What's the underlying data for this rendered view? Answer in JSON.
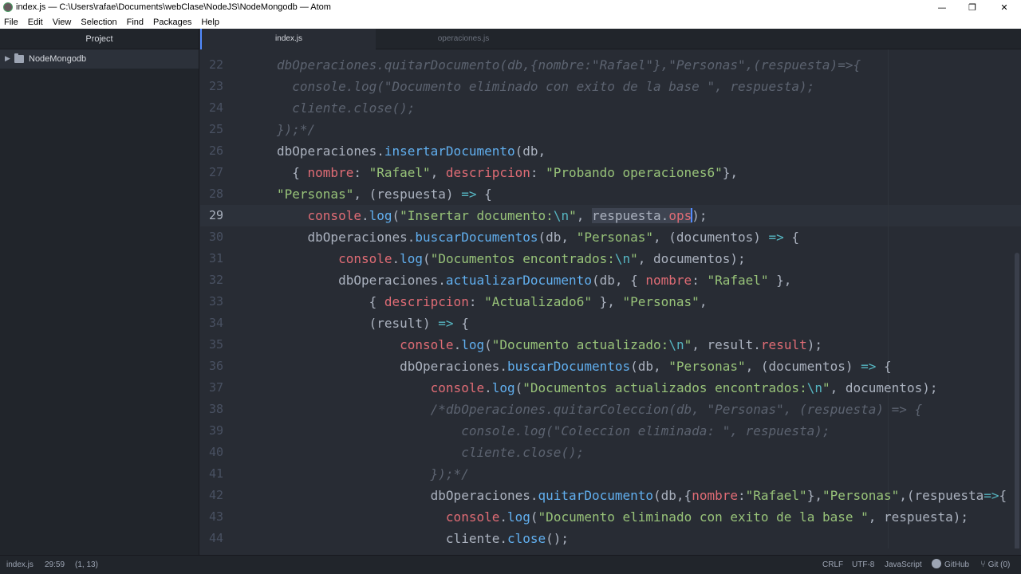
{
  "window": {
    "title": "index.js — C:\\Users\\rafae\\Documents\\webClase\\NodeJS\\NodeMongodb — Atom",
    "minimize_glyph": "—",
    "maximize_glyph": "❐",
    "close_glyph": "✕"
  },
  "menu": [
    "File",
    "Edit",
    "View",
    "Selection",
    "Find",
    "Packages",
    "Help"
  ],
  "tree": {
    "panel_title": "Project",
    "root_label": "NodeMongodb",
    "root_icon": "folder-icon"
  },
  "tabs": [
    {
      "label": "index.js",
      "active": true
    },
    {
      "label": "operaciones.js",
      "active": false
    }
  ],
  "editor": {
    "line_numbers": [
      "22",
      "23",
      "24",
      "25",
      "26",
      "27",
      "28",
      "29",
      "30",
      "31",
      "32",
      "33",
      "34",
      "35",
      "36",
      "37",
      "38",
      "39",
      "40",
      "41",
      "42",
      "43",
      "44"
    ],
    "current_line": "29",
    "lines": [
      [
        [
          "c",
          "dbOperaciones.quitarDocumento(db,{nombre:\"Rafael\"},\"Personas\",(respuesta)=>{"
        ]
      ],
      [
        [
          "c",
          "  console.log(\"Documento eliminado con exito de la base \", respuesta);"
        ]
      ],
      [
        [
          "c",
          "  cliente.close();"
        ]
      ],
      [
        [
          "c",
          "});*/"
        ]
      ],
      [
        [
          "t",
          "dbOperaciones."
        ],
        [
          "f",
          "insertarDocumento"
        ],
        [
          "t",
          "(db,"
        ]
      ],
      [
        [
          "t",
          "  { "
        ],
        [
          "k",
          "nombre"
        ],
        [
          "t",
          ": "
        ],
        [
          "s",
          "\"Rafael\""
        ],
        [
          "t",
          ", "
        ],
        [
          "k",
          "descripcion"
        ],
        [
          "t",
          ": "
        ],
        [
          "s",
          "\"Probando operaciones6\""
        ],
        [
          "t",
          "},"
        ]
      ],
      [
        [
          "s",
          "\"Personas\""
        ],
        [
          "t",
          ", (respuesta) "
        ],
        [
          "o",
          "=>"
        ],
        [
          "t",
          " {"
        ]
      ],
      [
        [
          "t",
          "    "
        ],
        [
          "k",
          "console"
        ],
        [
          "t",
          "."
        ],
        [
          "f",
          "log"
        ],
        [
          "t",
          "("
        ],
        [
          "s",
          "\"Insertar documento:"
        ],
        [
          "o",
          "\\n"
        ],
        [
          "s",
          "\""
        ],
        [
          "t",
          ", "
        ],
        [
          "sel",
          "respuesta."
        ],
        [
          "selk",
          "ops"
        ],
        [
          "caret",
          ""
        ],
        [
          "t",
          ");"
        ]
      ],
      [
        [
          "t",
          "    dbOperaciones."
        ],
        [
          "f",
          "buscarDocumentos"
        ],
        [
          "t",
          "(db, "
        ],
        [
          "s",
          "\"Personas\""
        ],
        [
          "t",
          ", (documentos) "
        ],
        [
          "o",
          "=>"
        ],
        [
          "t",
          " {"
        ]
      ],
      [
        [
          "t",
          "        "
        ],
        [
          "k",
          "console"
        ],
        [
          "t",
          "."
        ],
        [
          "f",
          "log"
        ],
        [
          "t",
          "("
        ],
        [
          "s",
          "\"Documentos encontrados:"
        ],
        [
          "o",
          "\\n"
        ],
        [
          "s",
          "\""
        ],
        [
          "t",
          ", documentos);"
        ]
      ],
      [
        [
          "t",
          "        dbOperaciones."
        ],
        [
          "f",
          "actualizarDocumento"
        ],
        [
          "t",
          "(db, { "
        ],
        [
          "k",
          "nombre"
        ],
        [
          "t",
          ": "
        ],
        [
          "s",
          "\"Rafael\""
        ],
        [
          "t",
          " },"
        ]
      ],
      [
        [
          "t",
          "            { "
        ],
        [
          "k",
          "descripcion"
        ],
        [
          "t",
          ": "
        ],
        [
          "s",
          "\"Actualizado6\""
        ],
        [
          "t",
          " }, "
        ],
        [
          "s",
          "\"Personas\""
        ],
        [
          "t",
          ","
        ]
      ],
      [
        [
          "t",
          "            (result) "
        ],
        [
          "o",
          "=>"
        ],
        [
          "t",
          " {"
        ]
      ],
      [
        [
          "t",
          "                "
        ],
        [
          "k",
          "console"
        ],
        [
          "t",
          "."
        ],
        [
          "f",
          "log"
        ],
        [
          "t",
          "("
        ],
        [
          "s",
          "\"Documento actualizado:"
        ],
        [
          "o",
          "\\n"
        ],
        [
          "s",
          "\""
        ],
        [
          "t",
          ", result."
        ],
        [
          "k",
          "result"
        ],
        [
          "t",
          ");"
        ]
      ],
      [
        [
          "t",
          "                dbOperaciones."
        ],
        [
          "f",
          "buscarDocumentos"
        ],
        [
          "t",
          "(db, "
        ],
        [
          "s",
          "\"Personas\""
        ],
        [
          "t",
          ", (documentos) "
        ],
        [
          "o",
          "=>"
        ],
        [
          "t",
          " {"
        ]
      ],
      [
        [
          "t",
          "                    "
        ],
        [
          "k",
          "console"
        ],
        [
          "t",
          "."
        ],
        [
          "f",
          "log"
        ],
        [
          "t",
          "("
        ],
        [
          "s",
          "\"Documentos actualizados encontrados:"
        ],
        [
          "o",
          "\\n"
        ],
        [
          "s",
          "\""
        ],
        [
          "t",
          ", documentos);"
        ]
      ],
      [
        [
          "t",
          "                    "
        ],
        [
          "c",
          "/*dbOperaciones.quitarColeccion(db, \"Personas\", (respuesta) => {"
        ]
      ],
      [
        [
          "c",
          "                        console.log(\"Coleccion eliminada: \", respuesta);"
        ]
      ],
      [
        [
          "c",
          "                        cliente.close();"
        ]
      ],
      [
        [
          "c",
          "                    });*/"
        ]
      ],
      [
        [
          "t",
          "                    dbOperaciones."
        ],
        [
          "f",
          "quitarDocumento"
        ],
        [
          "t",
          "(db,{"
        ],
        [
          "k",
          "nombre"
        ],
        [
          "t",
          ":"
        ],
        [
          "s",
          "\"Rafael\""
        ],
        [
          "t",
          "},"
        ],
        [
          "s",
          "\"Personas\""
        ],
        [
          "t",
          ",(respuesta"
        ],
        [
          "o",
          "=>"
        ],
        [
          "t",
          "{"
        ]
      ],
      [
        [
          "t",
          "                      "
        ],
        [
          "k",
          "console"
        ],
        [
          "t",
          "."
        ],
        [
          "f",
          "log"
        ],
        [
          "t",
          "("
        ],
        [
          "s",
          "\"Documento eliminado con exito de la base \""
        ],
        [
          "t",
          ", respuesta);"
        ]
      ],
      [
        [
          "t",
          "                      cliente."
        ],
        [
          "f",
          "close"
        ],
        [
          "t",
          "();"
        ]
      ]
    ]
  },
  "status": {
    "file": "index.js",
    "cursor": "29:59",
    "selection": "(1, 13)",
    "line_ending": "CRLF",
    "encoding": "UTF-8",
    "grammar": "JavaScript",
    "github": "GitHub",
    "git": "Git (0)"
  },
  "colors": {
    "comment": "#5c6370",
    "function": "#61afef",
    "string": "#98c379",
    "keyword": "#e06c75",
    "operator": "#56b6c2",
    "text": "#abb2bf",
    "cursor": "#528bff"
  }
}
